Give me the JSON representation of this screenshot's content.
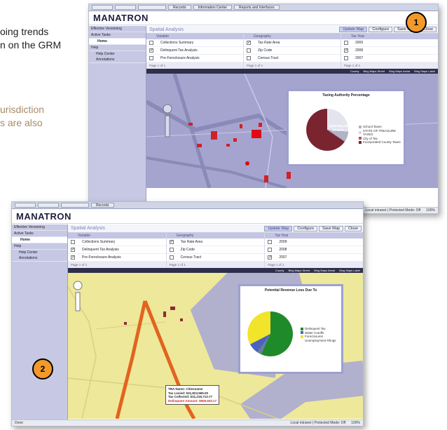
{
  "background_text": {
    "line1": "oing trends",
    "line2": "n on the GRM",
    "line3": "urisdiction",
    "line4": "s are also"
  },
  "badges": {
    "one": "1",
    "two": "2"
  },
  "app": {
    "logo": "MANATRON",
    "tabs": [
      "",
      "",
      "",
      "Records",
      "Information Center",
      "Reports and Interfaces"
    ],
    "sidebar": {
      "items": [
        "Effective Versioning",
        "Active Tasks",
        "Home",
        "Help",
        "Help Center",
        "Annotations"
      ]
    },
    "main": {
      "title": "Spatial Analysis",
      "buttons": [
        "Update Map",
        "Configure",
        "Save Map",
        "Close"
      ]
    },
    "columns": [
      {
        "header": "Variable",
        "items": [
          {
            "label": "Collections Summary",
            "checked": false
          },
          {
            "label": "Delinquent Tax Analysis",
            "checked": true
          },
          {
            "label": "Pre-Foreclosure Analysis",
            "checked": true
          }
        ]
      },
      {
        "header": "Geography",
        "items": [
          {
            "label": "Tax Rate Area",
            "checked": true
          },
          {
            "label": "Zip Code",
            "checked": false
          },
          {
            "label": "Census Tract",
            "checked": false
          }
        ]
      },
      {
        "header": "Tax Year",
        "items": [
          {
            "label": "2009",
            "checked": false
          },
          {
            "label": "2008",
            "checked": false
          },
          {
            "label": "2007",
            "checked": true
          }
        ]
      }
    ],
    "pager": {
      "page_label": "Page",
      "page": "1",
      "of": "of 1"
    },
    "map_toolbar": [
      "County",
      "Bing Maps Street",
      "Bing Maps Aerial",
      "Bing Maps Label"
    ],
    "status_left": "Done",
    "status_zone": "Local intranet | Protected Mode: Off",
    "status_zoom": "100%"
  },
  "popup_back": {
    "title": "Taxing Authority Percentage",
    "slice_label": "19397931.58",
    "slice_pct": "83.56 %",
    "legend": [
      "School Taxes",
      "STATE OF TREASURE TAXES",
      "City of Tax",
      "Incorporated County Taxes"
    ],
    "colors": [
      "#b1b3c7",
      "#d9d9e4",
      "#c44d52",
      "#7a2430"
    ]
  },
  "popup_front": {
    "title": "Potential Revenue Loss Due To",
    "legend": [
      "Delinquent Tax",
      "Water Cutoffs",
      "Foreclosures",
      "Unemployment Filings"
    ],
    "colors": [
      "#1f8a2a",
      "#4a63c0",
      "#f1e42a",
      "#6a7f9a"
    ]
  },
  "tooltip": {
    "line1": "TRA Name: Citiesname",
    "line2": "Tax Levied: $31,823,965.00",
    "line3": "Tax Collected: $31,218,713.77",
    "line4": "Delinquent Amount: $606,933.17"
  }
}
